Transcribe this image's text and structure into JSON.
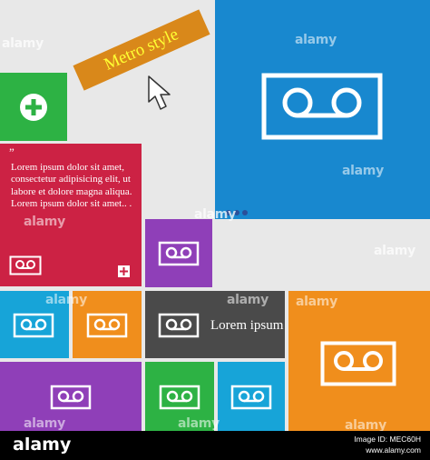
{
  "colors": {
    "background": "#e8e8e8",
    "green": "#2db244",
    "red": "#cc2244",
    "blue": "#1888cf",
    "purple": "#8f3fb8",
    "orange": "#f08e1c",
    "gray": "#4a4a4a",
    "cyan": "#17a4d8",
    "banner": "#d9881a",
    "banner_text": "#ffff33"
  },
  "banner": {
    "text": "Metro style"
  },
  "text_tile": {
    "quote": "”",
    "body": "Lorem ipsum dolor sit amet, consectetur adipisicing elit, ut labore et dolore magna aliqua. Lorem ipsum dolor sit amet.. ."
  },
  "gray_tile": {
    "label": "Lorem ipsum"
  },
  "watermark": {
    "text": "alamy"
  },
  "footer": {
    "logo": "alamy",
    "image_id": "Image ID: MEC60H",
    "site": "www.alamy.com"
  },
  "icons": {
    "cassette": "cassette-icon",
    "plus": "plus-icon",
    "cursor": "cursor-arrow-icon"
  }
}
